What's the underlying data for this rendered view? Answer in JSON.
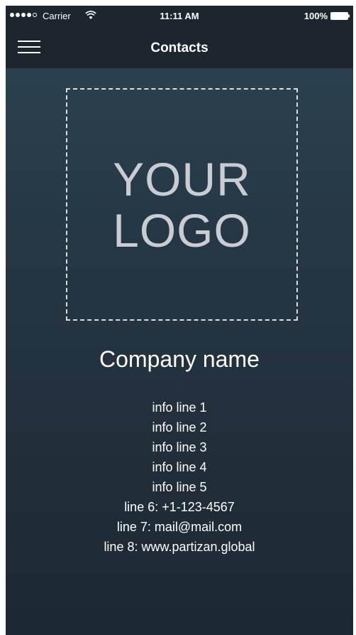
{
  "status_bar": {
    "carrier": "Carrier",
    "time": "11:11 AM",
    "battery": "100%"
  },
  "nav": {
    "title": "Contacts",
    "menu_icon": "hamburger-menu-icon"
  },
  "logo": {
    "line1": "YOUR",
    "line2": "LOGO"
  },
  "company_name": "Company name",
  "info_lines": [
    "info line 1",
    "info line 2",
    "info line 3",
    "info line 4",
    "info line 5",
    "line 6: +1-123-4567",
    "line 7: mail@mail.com",
    "line 8: www.partizan.global"
  ],
  "colors": {
    "bar_background": "#1b262f",
    "gradient_top": "#2d4452",
    "gradient_bottom": "#1c2832",
    "logo_text": "#c9cdd1",
    "text": "#ffffff"
  }
}
